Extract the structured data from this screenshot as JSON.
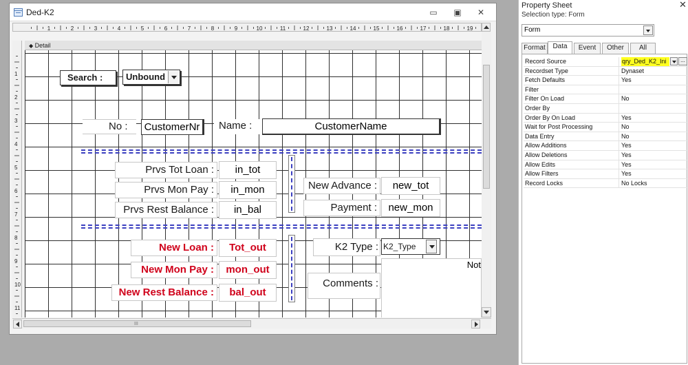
{
  "window": {
    "title": "Ded-K2",
    "minimize": "▭",
    "restore": "▣",
    "close": "✕"
  },
  "design": {
    "section_label": "Detail",
    "ruler_numbers": [
      "1",
      "2",
      "3",
      "4",
      "5",
      "6",
      "7",
      "8",
      "9",
      "10",
      "11",
      "12",
      "13",
      "14",
      "15",
      "16",
      "17",
      "18",
      "19"
    ],
    "vruler_numbers": [
      "1",
      "2",
      "3",
      "4",
      "5",
      "6",
      "7",
      "8",
      "9",
      "10",
      "11"
    ],
    "search": {
      "label": "Search :",
      "combo_value": "Unbound"
    },
    "no_label": "No :",
    "customer_nr": "CustomerNr",
    "name_label": "Name :",
    "customer_name": "CustomerName",
    "prvs_tot_loan": {
      "label": "Prvs Tot Loan :",
      "field": "in_tot"
    },
    "prvs_mon_pay": {
      "label": "Prvs Mon Pay :",
      "field": "in_mon"
    },
    "prvs_rest_balance": {
      "label": "Prvs Rest Balance :",
      "field": "in_bal"
    },
    "new_advance": {
      "label": "New Advance :",
      "field": "new_tot"
    },
    "payment": {
      "label": "Payment :",
      "field": "new_mon"
    },
    "new_loan": {
      "label": "New Loan :",
      "field": "Tot_out"
    },
    "new_mon_pay": {
      "label": "New Mon Pay :",
      "field": "mon_out"
    },
    "new_rest_balance": {
      "label": "New Rest Balance :",
      "field": "bal_out"
    },
    "k2_type": {
      "label": "K2 Type :",
      "combo_value": "K2_Type"
    },
    "comments_label": "Comments :",
    "notes_clip": "Not",
    "scroll_grip": "III"
  },
  "property_sheet": {
    "title": "Property Sheet",
    "close": "✕",
    "selection_type": "Selection type:  Form",
    "object_combo": "Form",
    "tabs": [
      "Format",
      "Data",
      "Event",
      "Other",
      "All"
    ],
    "active_tab": "Data",
    "properties": [
      {
        "name": "Record Source",
        "value": "qry_Ded_K2_Ini"
      },
      {
        "name": "Recordset Type",
        "value": "Dynaset"
      },
      {
        "name": "Fetch Defaults",
        "value": "Yes"
      },
      {
        "name": "Filter",
        "value": ""
      },
      {
        "name": "Filter On Load",
        "value": "No"
      },
      {
        "name": "Order By",
        "value": ""
      },
      {
        "name": "Order By On Load",
        "value": "Yes"
      },
      {
        "name": "Wait for Post Processing",
        "value": "No"
      },
      {
        "name": "Data Entry",
        "value": "No"
      },
      {
        "name": "Allow Additions",
        "value": "Yes"
      },
      {
        "name": "Allow Deletions",
        "value": "Yes"
      },
      {
        "name": "Allow Edits",
        "value": "Yes"
      },
      {
        "name": "Allow Filters",
        "value": "Yes"
      },
      {
        "name": "Record Locks",
        "value": "No Locks"
      }
    ],
    "builder_button": "...",
    "highlight_color": "#ffff20"
  },
  "colors": {
    "accent_red": "#d0021b",
    "dash_blue": "#3b3fc0"
  }
}
